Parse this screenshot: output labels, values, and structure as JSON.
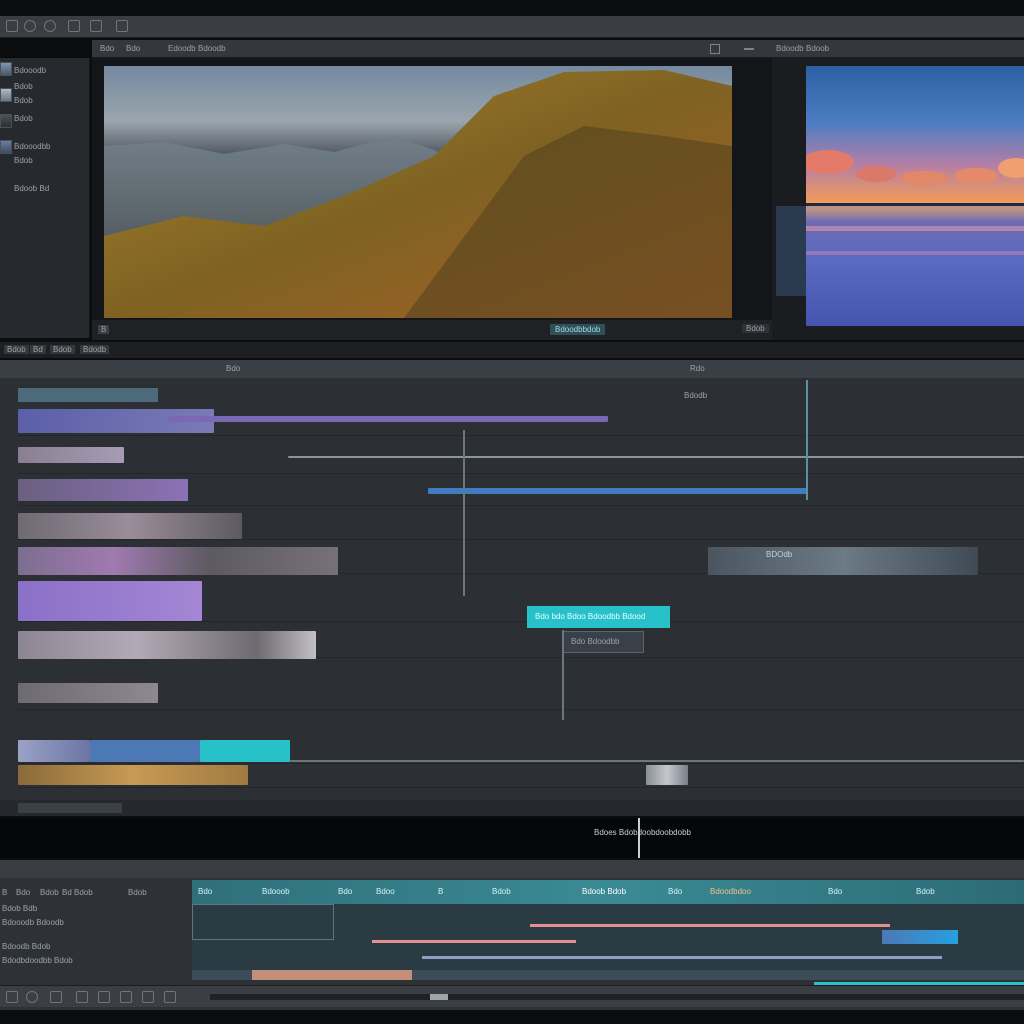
{
  "toolbar": {
    "icons": [
      "window-icon",
      "grid-icon",
      "clip-icon",
      "play-icon",
      "settings-icon",
      "media-icon"
    ]
  },
  "source_panel": {
    "header_labels": [
      "Bdo",
      "Bdo",
      "Edoodb",
      "Bdoodb"
    ],
    "viewer_timecode": "Bdoodbbdob",
    "viewer_left_label": "B",
    "header_icons": [
      "layout-icon",
      "close-icon"
    ]
  },
  "program_panel": {
    "header_labels": [
      "Bdoodb",
      "Bdoob"
    ],
    "viewer_label": "Bdob"
  },
  "media_bin": {
    "items": [
      "Bdooodb",
      "Bdob",
      "Bdob",
      "Bdob",
      "Bdooodbb",
      "Bdob",
      "Bdoob Bd"
    ]
  },
  "timeline": {
    "tabs": [
      "Bdob",
      "Bd",
      "Bdob",
      "Bdodb"
    ],
    "ruler_label": "Rdo",
    "ruler_label_left": "Bdo",
    "ruler_mark": "Bdodb",
    "clip_labels": {
      "teal_clip": "Bdo bdo Bdoo Bdoodbb Bdood",
      "grey_clip": "Bdo Bdoodbb",
      "right_cluster": "BDOdb"
    }
  },
  "caption": {
    "text": "Bdoes Bdobdoobdoobdobb"
  },
  "audio": {
    "channel_labels": [
      "Bdob Bdb",
      "Bdooodb Bdoodb",
      "Bdoodb Bdob",
      "Bdodbdoodbb Bdob"
    ],
    "header_left": [
      "B",
      "Bdo",
      "Bdob",
      "Bd",
      "Bdob"
    ],
    "header_bd": "Bdob",
    "strip_labels": [
      "Bdo",
      "Bdooob",
      "Bdo",
      "Bdoo",
      "B",
      "Bdob",
      "Bdoob Bdob",
      "Bdo",
      "Bdoodbdoo",
      "Bdo",
      "Bdob"
    ]
  },
  "colors": {
    "accent_teal": "#27c2c9",
    "clip_purple": "#8a6fc8",
    "clip_blue": "#4c78b6",
    "clip_orange": "#c79a55"
  }
}
